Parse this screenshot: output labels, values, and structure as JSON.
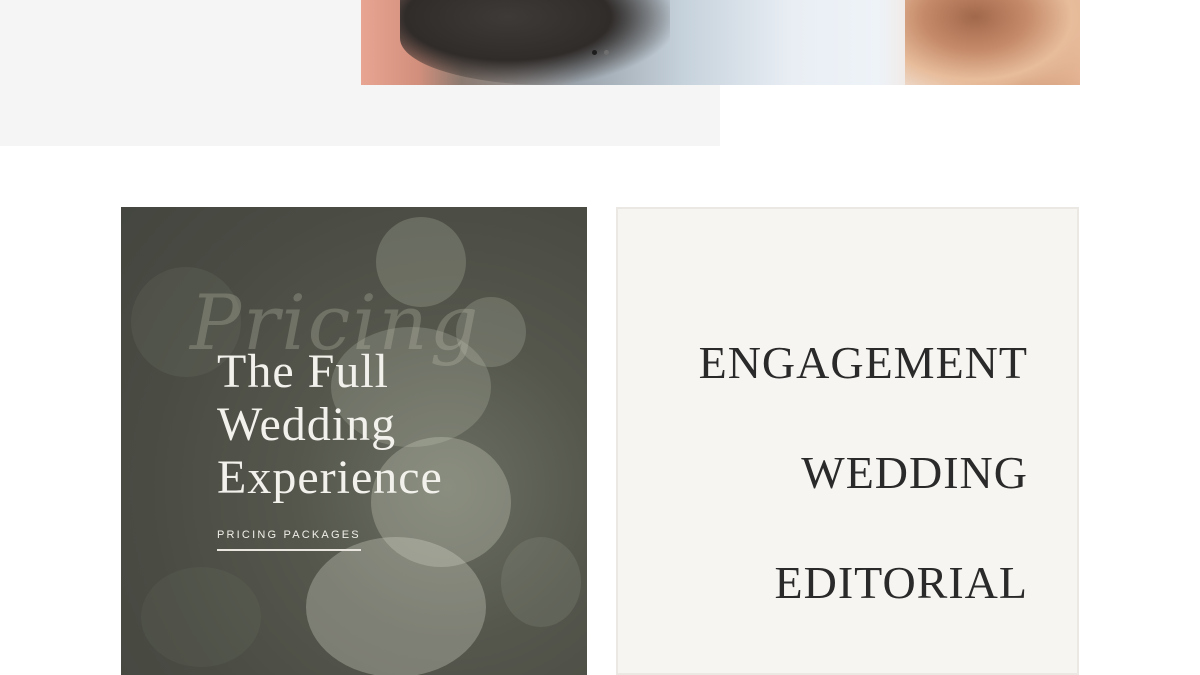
{
  "hero": {
    "carousel_dots": [
      {
        "state": "active",
        "color": "#1d1d1d"
      },
      {
        "state": "inactive",
        "color": "#6f6f6f"
      }
    ]
  },
  "pricing_card": {
    "script_word": "Pricing",
    "title": "The Full Wedding Experience",
    "link_label": "PRICING PACKAGES"
  },
  "categories": {
    "items": [
      "ENGAGEMENT",
      "WEDDING",
      "EDITORIAL"
    ]
  },
  "colors": {
    "card_overlay": "#4a4c44",
    "cream_background": "#f7f5f1",
    "heading_dark": "#2a2a2a",
    "light_text": "#f3f1ec"
  }
}
